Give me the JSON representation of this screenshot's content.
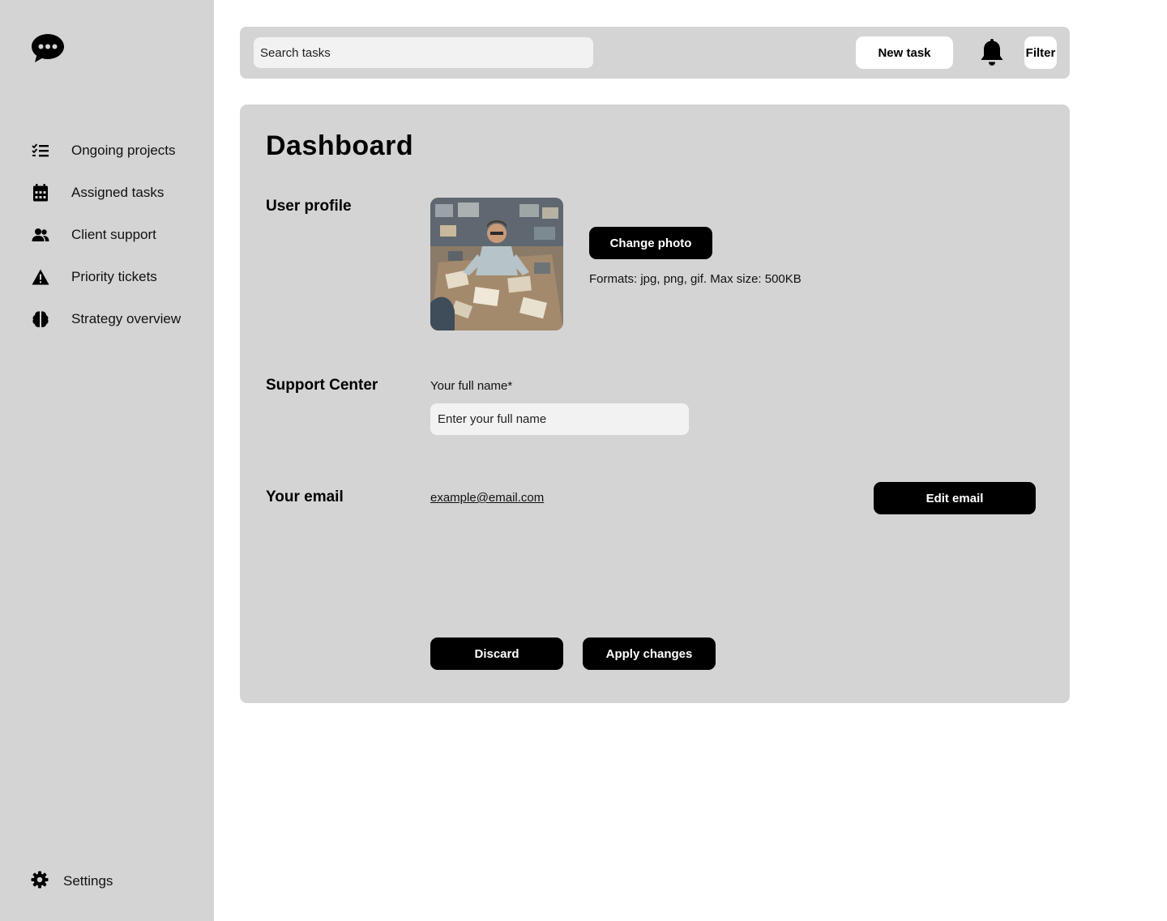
{
  "sidebar": {
    "logo_icon": "chat-bubble-icon",
    "items": [
      {
        "label": "Ongoing projects",
        "icon": "checklist-icon"
      },
      {
        "label": "Assigned tasks",
        "icon": "calendar-icon"
      },
      {
        "label": "Client support",
        "icon": "users-icon"
      },
      {
        "label": "Priority tickets",
        "icon": "warning-icon"
      },
      {
        "label": "Strategy overview",
        "icon": "brain-icon"
      }
    ],
    "settings": {
      "label": "Settings",
      "icon": "gear-icon"
    }
  },
  "topbar": {
    "search_placeholder": "Search tasks",
    "new_task_label": "New task",
    "bell_icon": "bell-icon",
    "filter_label": "Filter"
  },
  "main": {
    "title": "Dashboard",
    "profile": {
      "section_label": "User profile",
      "change_photo_label": "Change photo",
      "formats_text": "Formats: jpg, png, gif. Max size: 500KB"
    },
    "support": {
      "section_label": "Support Center",
      "name_label": "Your full name*",
      "name_placeholder": "Enter your full name",
      "name_value": ""
    },
    "email": {
      "section_label": "Your email",
      "value": "example@email.com",
      "edit_label": "Edit email"
    },
    "actions": {
      "discard_label": "Discard",
      "apply_label": "Apply changes"
    }
  },
  "colors": {
    "sidebar_bg": "#d4d4d4",
    "panel_bg": "#d4d4d4",
    "input_bg": "#f2f2f2",
    "button_dark": "#000000",
    "button_light": "#ffffff"
  }
}
